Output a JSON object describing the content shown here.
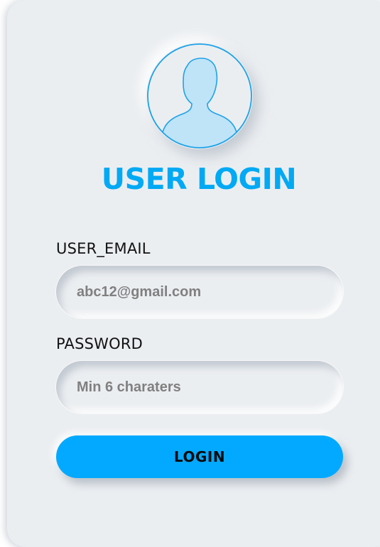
{
  "form": {
    "title": "USER LOGIN",
    "avatar_icon": "user-avatar-icon",
    "email_label": "USER_EMAIL",
    "email_placeholder": "abc12@gmail.com",
    "email_value": "",
    "password_label": "PASSWORD",
    "password_placeholder": "Min 6 charaters",
    "password_value": "",
    "login_label": "LOGIN"
  },
  "colors": {
    "accent": "#02a9f4",
    "button": "#02a9ff",
    "background": "#ebeef1",
    "avatar_fill": "#bfe3f7",
    "avatar_stroke": "#1ea3e8"
  }
}
